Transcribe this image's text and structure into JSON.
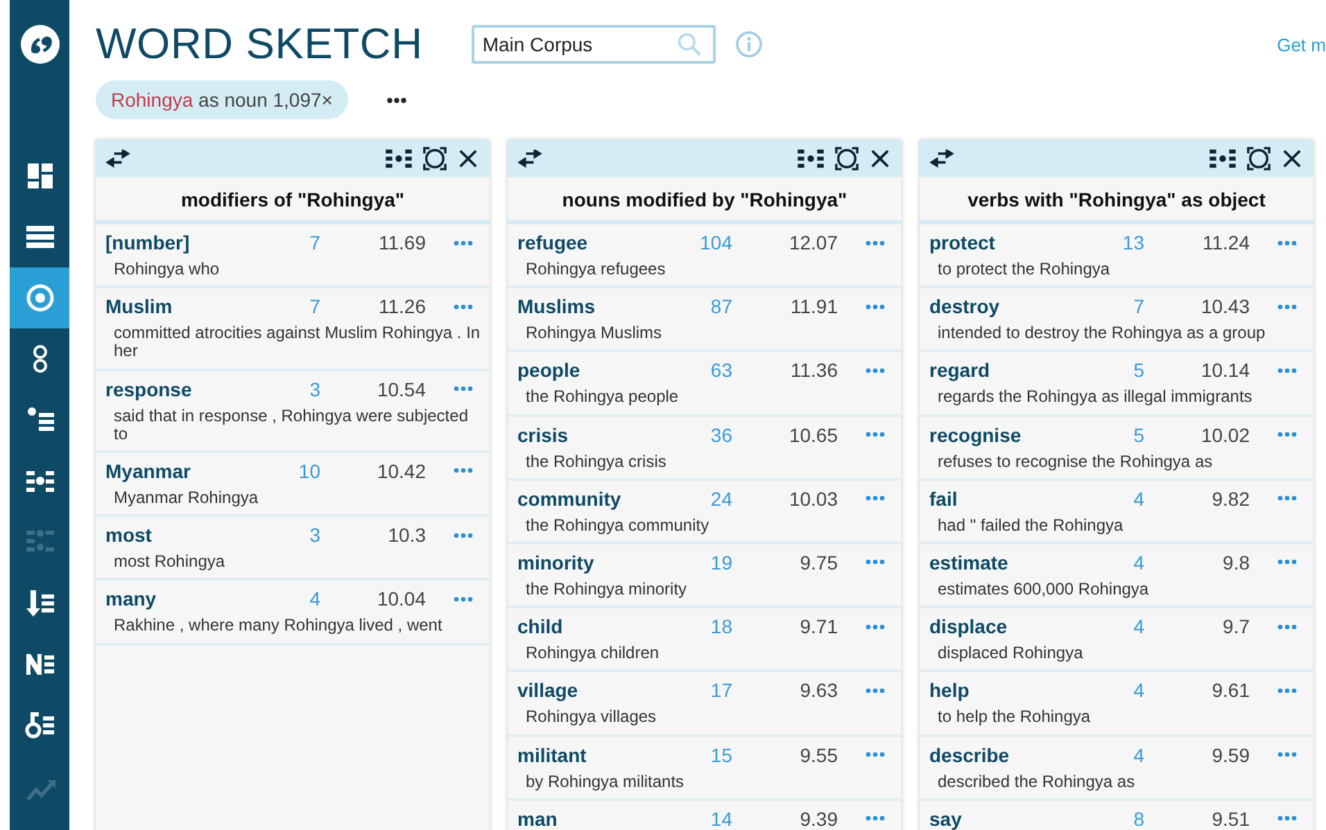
{
  "sidebar": {
    "items": [
      {
        "selected": false,
        "disabled": false
      },
      {
        "selected": false,
        "disabled": false
      },
      {
        "selected": true,
        "disabled": false
      },
      {
        "selected": false,
        "disabled": false
      },
      {
        "selected": false,
        "disabled": false
      },
      {
        "selected": false,
        "disabled": false
      },
      {
        "selected": false,
        "disabled": true
      },
      {
        "selected": false,
        "disabled": false
      },
      {
        "selected": false,
        "disabled": false
      },
      {
        "selected": false,
        "disabled": false
      },
      {
        "selected": false,
        "disabled": true
      }
    ]
  },
  "header": {
    "title": "WORD SKETCH",
    "corpus_field": {
      "value": "Main Corpus"
    },
    "link": "Get m"
  },
  "query_chip": {
    "lemma": "Rohingya",
    "text": "as noun 1,097×"
  },
  "panels": [
    {
      "title": "modifiers of \"Rohingya\"",
      "rows": [
        {
          "word": "[number]",
          "count": "7",
          "score": "11.69",
          "example": "Rohingya who"
        },
        {
          "word": "Muslim",
          "count": "7",
          "score": "11.26",
          "example": "committed atrocities against Muslim Rohingya . In her"
        },
        {
          "word": "response",
          "count": "3",
          "score": "10.54",
          "example": "said that in response , Rohingya were subjected to"
        },
        {
          "word": "Myanmar",
          "count": "10",
          "score": "10.42",
          "example": "Myanmar Rohingya"
        },
        {
          "word": "most",
          "count": "3",
          "score": "10.3",
          "example": "most Rohingya"
        },
        {
          "word": "many",
          "count": "4",
          "score": "10.04",
          "example": "Rakhine , where many Rohingya lived , went"
        }
      ]
    },
    {
      "title": "nouns modified by \"Rohingya\"",
      "rows": [
        {
          "word": "refugee",
          "count": "104",
          "score": "12.07",
          "example": "Rohingya refugees"
        },
        {
          "word": "Muslims",
          "count": "87",
          "score": "11.91",
          "example": "Rohingya Muslims"
        },
        {
          "word": "people",
          "count": "63",
          "score": "11.36",
          "example": "the Rohingya people"
        },
        {
          "word": "crisis",
          "count": "36",
          "score": "10.65",
          "example": "the Rohingya crisis"
        },
        {
          "word": "community",
          "count": "24",
          "score": "10.03",
          "example": "the Rohingya community"
        },
        {
          "word": "minority",
          "count": "19",
          "score": "9.75",
          "example": "the Rohingya minority"
        },
        {
          "word": "child",
          "count": "18",
          "score": "9.71",
          "example": "Rohingya children"
        },
        {
          "word": "village",
          "count": "17",
          "score": "9.63",
          "example": "Rohingya villages"
        },
        {
          "word": "militant",
          "count": "15",
          "score": "9.55",
          "example": "by Rohingya militants"
        },
        {
          "word": "man",
          "count": "14",
          "score": "9.39"
        }
      ]
    },
    {
      "title": "verbs with \"Rohingya\" as object",
      "rows": [
        {
          "word": "protect",
          "count": "13",
          "score": "11.24",
          "example": "to protect the Rohingya"
        },
        {
          "word": "destroy",
          "count": "7",
          "score": "10.43",
          "example": "intended to destroy the Rohingya as a group"
        },
        {
          "word": "regard",
          "count": "5",
          "score": "10.14",
          "example": "regards the Rohingya as illegal immigrants"
        },
        {
          "word": "recognise",
          "count": "5",
          "score": "10.02",
          "example": "refuses to recognise the Rohingya as"
        },
        {
          "word": "fail",
          "count": "4",
          "score": "9.82",
          "example": "had \" failed the Rohingya"
        },
        {
          "word": "estimate",
          "count": "4",
          "score": "9.8",
          "example": "estimates 600,000 Rohingya"
        },
        {
          "word": "displace",
          "count": "4",
          "score": "9.7",
          "example": "displaced Rohingya"
        },
        {
          "word": "help",
          "count": "4",
          "score": "9.61",
          "example": "to help the Rohingya"
        },
        {
          "word": "describe",
          "count": "4",
          "score": "9.59",
          "example": "described the Rohingya as"
        },
        {
          "word": "say",
          "count": "8",
          "score": "9.51"
        }
      ]
    }
  ]
}
